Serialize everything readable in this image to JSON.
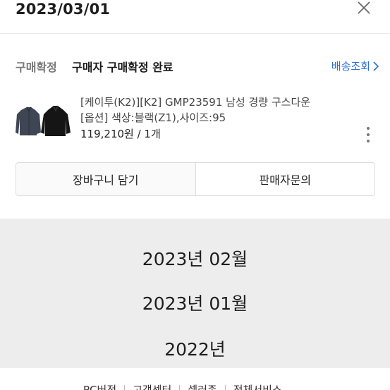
{
  "header": {
    "date": "2023/03/01",
    "close_icon": "close-icon"
  },
  "order": {
    "status_tag": "구매확정",
    "status_text": "구매자 구매확정 완료",
    "tracking_label": "배송조회",
    "product": {
      "name": "[케이투(K2)][K2] GMP23591 남성 경량 구스다운",
      "option": "[옵션] 색상:블랙(Z1),사이즈:95",
      "price_qty": "119,210원 / 1개",
      "thumbnail_icon": "jacket-thumbnail",
      "more_icon": "more-vertical-icon"
    },
    "buttons": {
      "cart": "장바구니 담기",
      "inquiry": "판매자문의"
    }
  },
  "periods": [
    "2023년 02월",
    "2023년 01월",
    "2022년"
  ],
  "footer": {
    "links": [
      "PC버전",
      "고객센터",
      "셀러존",
      "전체서비스"
    ]
  },
  "colors": {
    "accent": "#2d6fd6",
    "period_background": "#ededed"
  }
}
